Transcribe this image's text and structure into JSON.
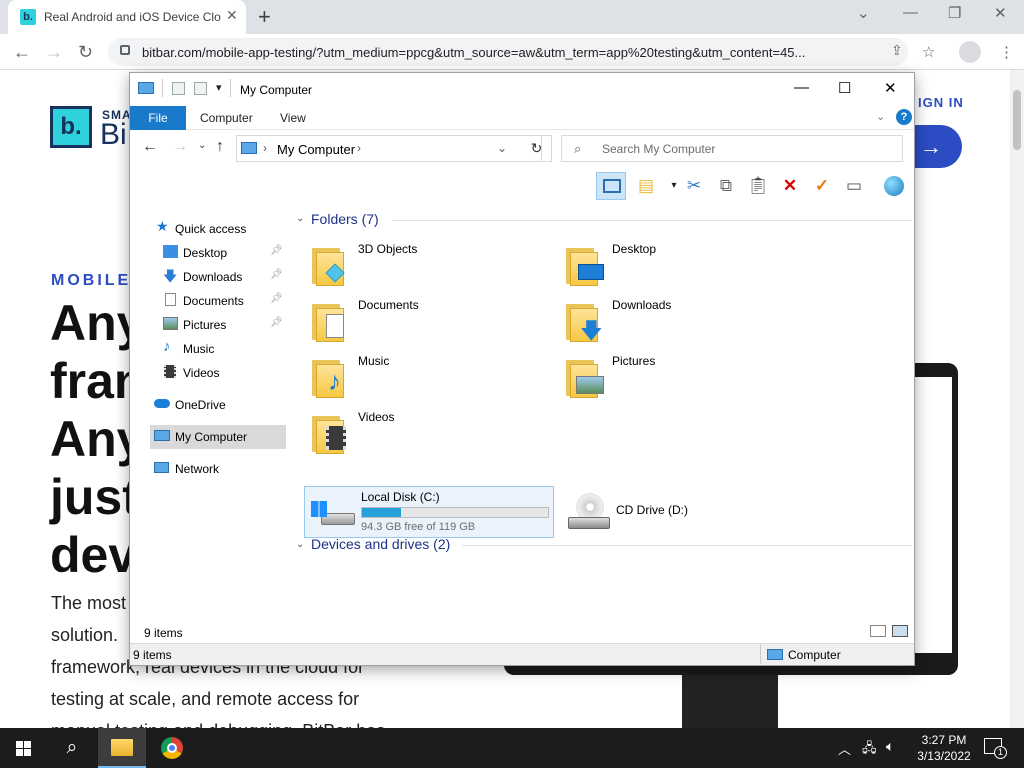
{
  "browser": {
    "tab_title": "Real Android and iOS Device Clo",
    "tab_favicon": "b.",
    "url": "bitbar.com/mobile-app-testing/?utm_medium=ppcg&utm_source=aw&utm_term=app%20testing&utm_content=45..."
  },
  "site": {
    "logo_letter": "b.",
    "logo_small": "SMA",
    "logo_big": "Bi",
    "signin": "IGN IN",
    "cta_arrow": "→",
    "eyebrow": "MOBILE A",
    "hero": [
      "Any",
      "fran",
      "Any",
      "just",
      "dev"
    ],
    "para": [
      "The most",
      "solution.",
      "framework, real devices in the cloud for",
      "testing at scale, and remote access for",
      "manual testing and debugging. BitBar has"
    ]
  },
  "explorer": {
    "window_title": "My Computer",
    "ribbon_tabs": [
      "File",
      "Computer",
      "View"
    ],
    "breadcrumb": "My Computer",
    "search_placeholder": "Search My Computer",
    "nav": [
      {
        "label": "Quick access",
        "icon": "star-icon",
        "pinned": false
      },
      {
        "label": "Desktop",
        "icon": "desktop-icon",
        "pinned": true
      },
      {
        "label": "Downloads",
        "icon": "download-icon",
        "pinned": true
      },
      {
        "label": "Documents",
        "icon": "documents-icon",
        "pinned": true
      },
      {
        "label": "Pictures",
        "icon": "pictures-icon",
        "pinned": true
      },
      {
        "label": "Music",
        "icon": "music-icon",
        "pinned": false
      },
      {
        "label": "Videos",
        "icon": "videos-icon",
        "pinned": false
      },
      {
        "label": "OneDrive",
        "icon": "cloud-icon",
        "pinned": false
      },
      {
        "label": "My Computer",
        "icon": "computer-icon",
        "pinned": false
      },
      {
        "label": "Network",
        "icon": "network-icon",
        "pinned": false
      }
    ],
    "folders_heading": "Folders (7)",
    "folders": [
      "3D Objects",
      "Desktop",
      "Documents",
      "Downloads",
      "Music",
      "Pictures",
      "Videos"
    ],
    "drives_heading": "Devices and drives (2)",
    "drive_c": {
      "name": "Local Disk (C:)",
      "size": "94.3 GB free of 119 GB",
      "used_fraction": 0.21
    },
    "drive_d": {
      "name": "CD Drive (D:)"
    },
    "status_items": "9 items",
    "bottom_items": "9 items",
    "bottom_location": "Computer"
  },
  "taskbar": {
    "time": "3:27 PM",
    "date": "3/13/2022",
    "notification_count": "1"
  },
  "colors": {
    "accent": "#1979ca",
    "brand": "#2c4cc4",
    "drive_bar": "#26a0da"
  }
}
